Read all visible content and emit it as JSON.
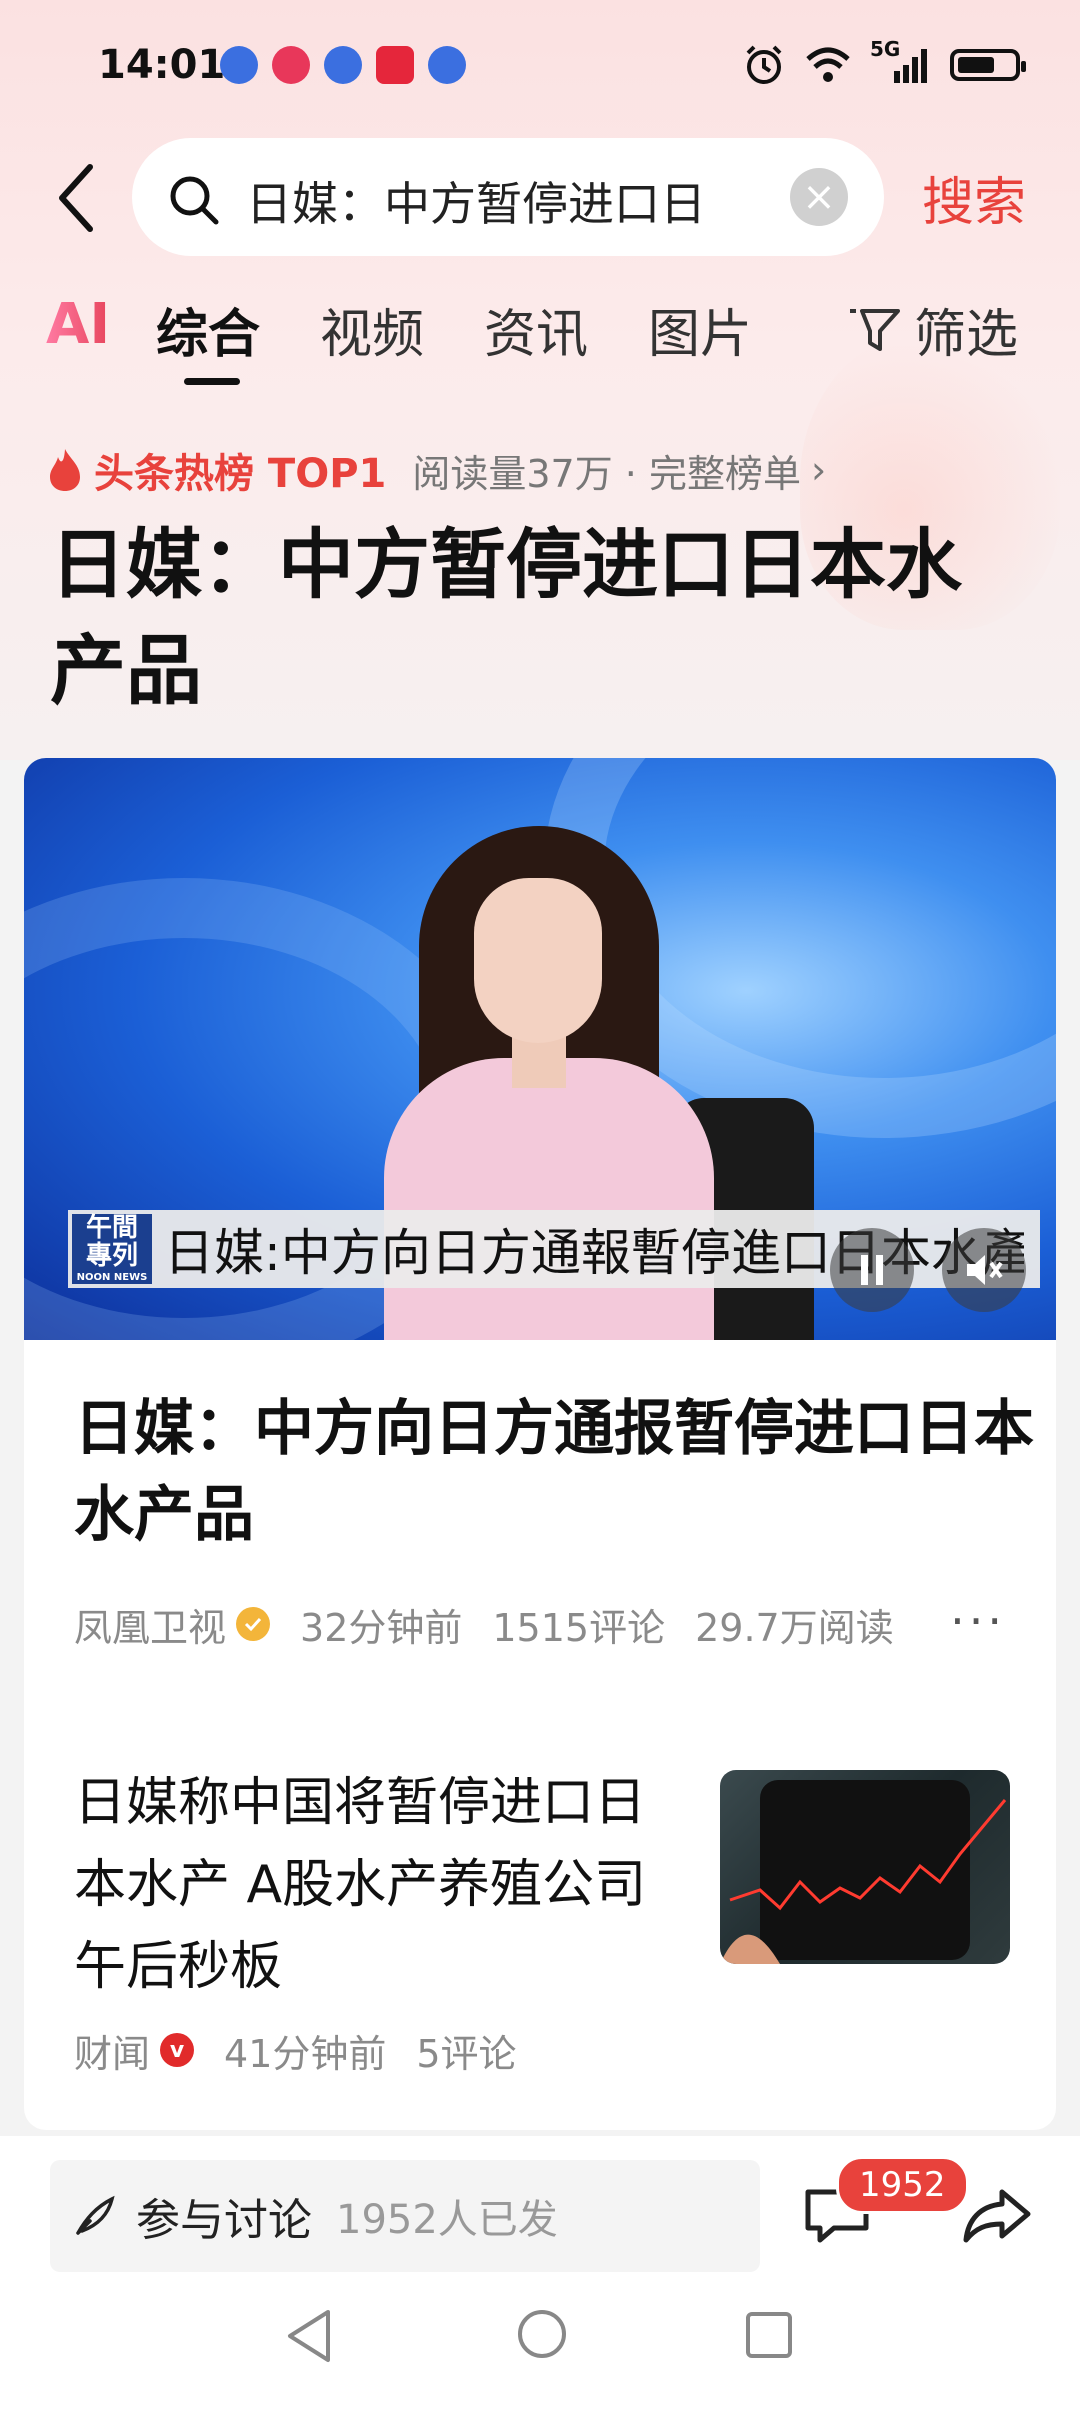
{
  "status_bar": {
    "time": "14:01",
    "network": "5G"
  },
  "search": {
    "query": "日媒：中方暂停进口日",
    "submit_label": "搜索"
  },
  "tabs": [
    {
      "label": "AI"
    },
    {
      "label": "综合",
      "active": true
    },
    {
      "label": "视频"
    },
    {
      "label": "资讯"
    },
    {
      "label": "图片"
    }
  ],
  "filter_label": "筛选",
  "hot_rank": {
    "label": "头条热榜 TOP1",
    "meta": "阅读量37万 · 完整榜单"
  },
  "topic_title": "日媒：中方暂停进口日本水产品",
  "video_card": {
    "caption_logo_line1": "午間",
    "caption_logo_line2": "專列",
    "caption_logo_sub": "NOON NEWS",
    "caption_text": "日媒:中方向日方通報暫停進口日本水產品",
    "title": "日媒：中方向日方通报暂停进口日本水产品",
    "source": "凤凰卫视",
    "time_ago": "32分钟前",
    "comments": "1515评论",
    "reads": "29.7万阅读"
  },
  "article2": {
    "title": "日媒称中国将暂停进口日本水产 A股水产养殖公司午后秒板",
    "source": "财闻",
    "time_ago": "41分钟前",
    "comments": "5评论"
  },
  "bottom_bar": {
    "discuss_label": "参与讨论",
    "discuss_count": "1952人已发",
    "comment_badge": "1952"
  },
  "colors": {
    "accent_red": "#e8423c",
    "hot_red": "#e8423c",
    "verify_gold": "#f3b53a"
  }
}
